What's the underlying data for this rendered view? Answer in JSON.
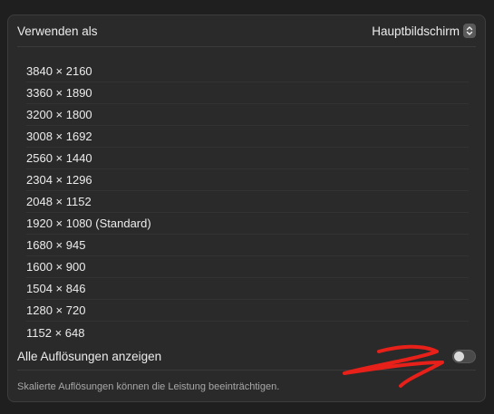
{
  "header": {
    "label": "Verwenden als",
    "select_value": "Hauptbildschirm"
  },
  "resolutions": [
    "3840 × 2160",
    "3360 × 1890",
    "3200 × 1800",
    "3008 × 1692",
    "2560 × 1440",
    "2304 × 1296",
    "2048 × 1152",
    "1920 × 1080 (Standard)",
    "1680 × 945",
    "1600 × 900",
    "1504 × 846",
    "1280 × 720",
    "1152 × 648"
  ],
  "show_all": {
    "label": "Alle Auflösungen anzeigen",
    "enabled": false
  },
  "note": "Skalierte Auflösungen können die Leistung beeinträchtigen.",
  "colors": {
    "background": "#1f1f1f",
    "panel": "#2a2a2a",
    "annotation": "#e8201a"
  },
  "icons": {
    "stepper": "chevron-up-down-icon"
  }
}
